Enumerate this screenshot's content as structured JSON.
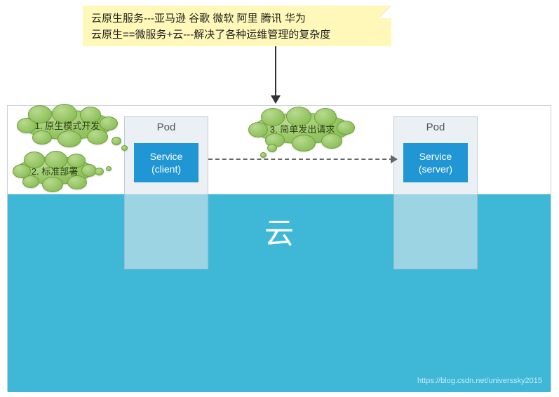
{
  "note": {
    "line1": "云原生服务---亚马逊 谷歌 微软 阿里  腾讯  华为",
    "line2": "云原生==微服务+云---解决了各种运维管理的复杂度"
  },
  "pods": {
    "left": {
      "label": "Pod",
      "service_name": "Service",
      "service_role": "(client)"
    },
    "right": {
      "label": "Pod",
      "service_name": "Service",
      "service_role": "(server)"
    }
  },
  "thoughts": {
    "t1": "1. 原生模式开发",
    "t2": "2. 标准部署",
    "t3": "3. 简单发出请求"
  },
  "cloud": {
    "label": "云"
  },
  "watermark": "https://blog.csdn.net/universsky2015"
}
